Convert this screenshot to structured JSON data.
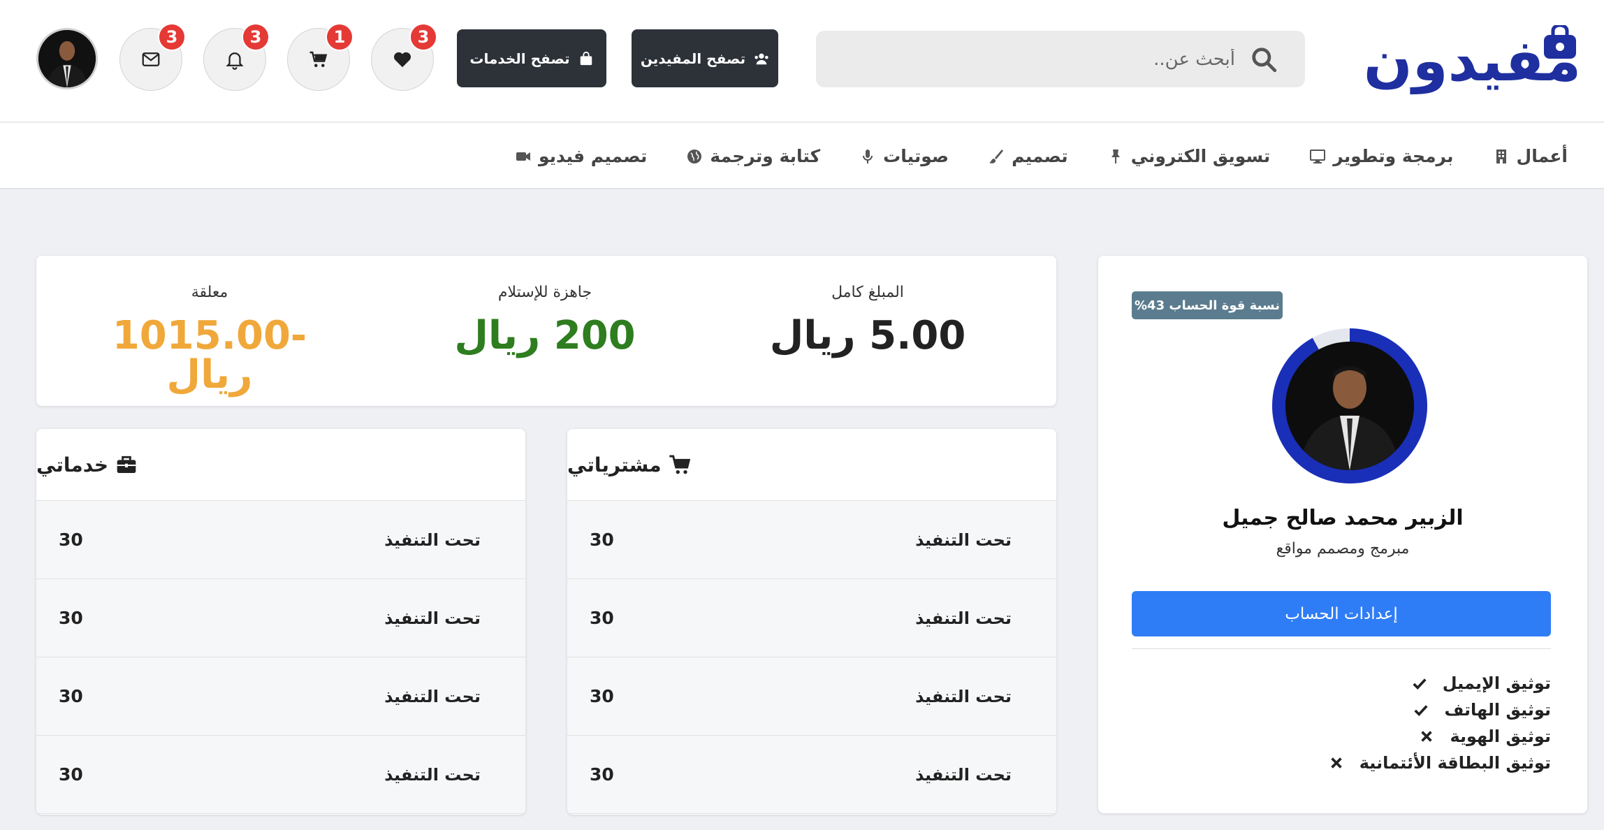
{
  "header": {
    "logo_text": "مفيدون",
    "search": {
      "placeholder": "أبحث عن.."
    },
    "browse_helpers_label": "تصفح المفيدين",
    "browse_services_label": "تصفح الخدمات",
    "favorites_count": "3",
    "cart_count": "1",
    "notifications_count": "3",
    "messages_count": "3"
  },
  "categories": [
    {
      "label": "أعمال",
      "icon": "building-icon"
    },
    {
      "label": "برمجة وتطوير",
      "icon": "desktop-icon"
    },
    {
      "label": "تسويق الكتروني",
      "icon": "pin-icon"
    },
    {
      "label": "تصميم",
      "icon": "brush-icon"
    },
    {
      "label": "صوتيات",
      "icon": "microphone-icon"
    },
    {
      "label": "كتابة وترجمة",
      "icon": "globe-icon"
    },
    {
      "label": "تصميم فيديو",
      "icon": "video-camera-icon"
    }
  ],
  "profile": {
    "strength_label": "نسبة قوة الحساب 43%",
    "strength_percent": 0.43,
    "ring_color": "#1a2fb8",
    "name": "الزبير محمد صالح جميل",
    "role": "مبرمج ومصمم مواقع",
    "settings_button": "إعدادات الحساب",
    "verifications": [
      {
        "label": "توثيق الإيميل",
        "verified": true
      },
      {
        "label": "توثيق الهاتف",
        "verified": true
      },
      {
        "label": "توثيق الهوية",
        "verified": false
      },
      {
        "label": "توثيق البطاقة الأئتمانية",
        "verified": false
      }
    ]
  },
  "stats": {
    "total": {
      "label": "المبلغ كامل",
      "value": "5.00 ريال",
      "color": "#222222"
    },
    "ready": {
      "label": "جاهزة للإستلام",
      "value": "200 ريال",
      "color": "#2e7d1f"
    },
    "pending": {
      "label": "معلقة",
      "value": "-1015.00 ريال",
      "color": "#f0a83a"
    }
  },
  "purchases": {
    "title": "مشترياتي",
    "rows": [
      {
        "status": "تحت التنفيذ",
        "count": "30"
      },
      {
        "status": "تحت التنفيذ",
        "count": "30"
      },
      {
        "status": "تحت التنفيذ",
        "count": "30"
      },
      {
        "status": "تحت التنفيذ",
        "count": "30"
      }
    ]
  },
  "services": {
    "title": "خدماتي",
    "rows": [
      {
        "status": "تحت التنفيذ",
        "count": "30"
      },
      {
        "status": "تحت التنفيذ",
        "count": "30"
      },
      {
        "status": "تحت التنفيذ",
        "count": "30"
      },
      {
        "status": "تحت التنفيذ",
        "count": "30"
      }
    ]
  }
}
